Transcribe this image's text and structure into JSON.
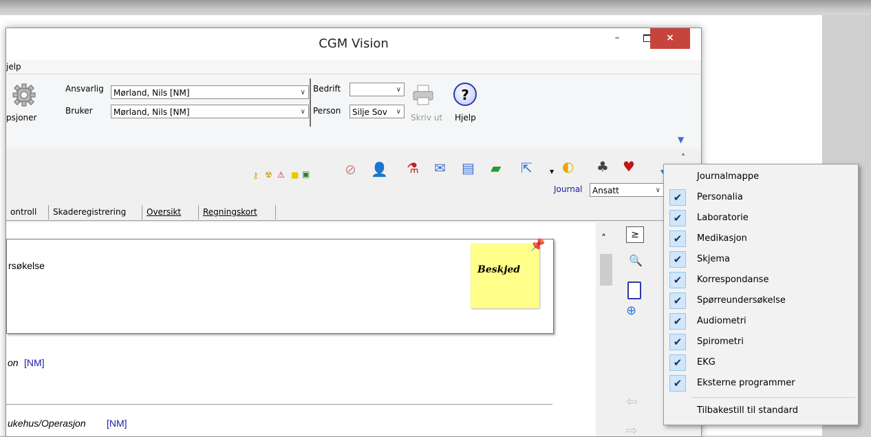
{
  "window": {
    "title": "CGM Vision",
    "minimize": "–",
    "close": "×"
  },
  "menu": {
    "help": "jelp"
  },
  "ribbon": {
    "options_label": "psjoner",
    "ansvarlig_label": "Ansvarlig",
    "ansvarlig_value": "Mørland, Nils [NM]",
    "bruker_label": "Bruker",
    "bruker_value": "Mørland, Nils [NM]",
    "bedrift_label": "Bedrift",
    "bedrift_value": "",
    "person_label": "Person",
    "person_value": "Silje Sov",
    "print_label": "Skriv ut",
    "help_label": "Hjelp",
    "help_glyph": "?",
    "icons": [
      "gear-icon",
      "printer-icon",
      "help-icon"
    ]
  },
  "toolbar": {
    "journal_label": "Journal",
    "journal_value": "Ansatt",
    "icons": [
      "key-icon",
      "radiation-icon",
      "warning-icon",
      "note-icon",
      "image-icon",
      "no-id-icon",
      "person-icon",
      "test-tube-icon",
      "mail-icon",
      "list-icon",
      "document-icon",
      "external-link-icon",
      "ear-icon",
      "lungs-icon",
      "heart-icon"
    ]
  },
  "tabs": [
    "ontroll",
    "Skaderegistrering",
    "Oversikt",
    "Regningskort"
  ],
  "content": {
    "line1": "rsøkelse",
    "line2_italic": "on",
    "line2_initials": "[NM]",
    "line3_italic": "ukehus/Operasjon",
    "line3_initials": "[NM]",
    "sticky": "Beskjed"
  },
  "side_buttons": {
    "next": "≥"
  },
  "dropdown": {
    "items": [
      {
        "label": "Journalmappe",
        "checked": false
      },
      {
        "label": "Personalia",
        "checked": true
      },
      {
        "label": "Laboratorie",
        "checked": true
      },
      {
        "label": "Medikasjon",
        "checked": true
      },
      {
        "label": "Skjema",
        "checked": true
      },
      {
        "label": "Korrespondanse",
        "checked": true
      },
      {
        "label": "Spørreundersøkelse",
        "checked": true
      },
      {
        "label": "Audiometri",
        "checked": true
      },
      {
        "label": "Spirometri",
        "checked": true
      },
      {
        "label": "EKG",
        "checked": true
      },
      {
        "label": "Eksterne programmer",
        "checked": true
      }
    ],
    "reset": "Tilbakestill til standard",
    "check_glyph": "✔"
  }
}
